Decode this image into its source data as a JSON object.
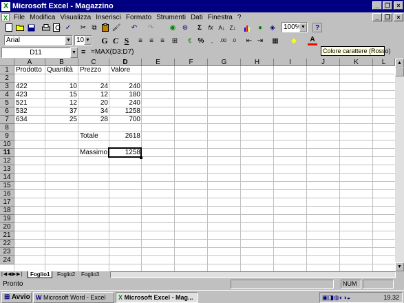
{
  "app": {
    "title": "Microsoft Excel - Magazzino"
  },
  "menu": [
    "File",
    "Modifica",
    "Visualizza",
    "Inserisci",
    "Formato",
    "Strumenti",
    "Dati",
    "Finestra",
    "?"
  ],
  "toolbar": {
    "zoom": "100%",
    "font": "Arial",
    "font_size": "10",
    "bold": "G",
    "italic": "C",
    "underline": "S",
    "percent": "%",
    "sum": "Σ",
    "fx": "fx"
  },
  "tooltip": "Colore carattere (Rosso)",
  "formula_bar": {
    "name_box": "D11",
    "equals": "=",
    "formula": "=MAX(D3:D7)"
  },
  "columns": [
    "A",
    "B",
    "C",
    "D",
    "E",
    "F",
    "G",
    "H",
    "I",
    "J",
    "K",
    "L"
  ],
  "rows": [
    "1",
    "2",
    "3",
    "4",
    "5",
    "6",
    "7",
    "8",
    "9",
    "10",
    "11",
    "12",
    "13",
    "14",
    "15",
    "16",
    "17",
    "18",
    "19",
    "20",
    "21",
    "22",
    "23",
    "24"
  ],
  "sheet": {
    "headers": {
      "prodotto": "Prodotto",
      "quantita": "Quantità",
      "prezzo": "Prezzo",
      "valore": "Valore"
    },
    "data": [
      {
        "prodotto": "422",
        "quantita": "10",
        "prezzo": "24",
        "valore": "240"
      },
      {
        "prodotto": "423",
        "quantita": "15",
        "prezzo": "12",
        "valore": "180"
      },
      {
        "prodotto": "521",
        "quantita": "12",
        "prezzo": "20",
        "valore": "240"
      },
      {
        "prodotto": "532",
        "quantita": "37",
        "prezzo": "34",
        "valore": "1258"
      },
      {
        "prodotto": "634",
        "quantita": "25",
        "prezzo": "28",
        "valore": "700"
      }
    ],
    "totale_label": "Totale",
    "totale_value": "2618",
    "massimo_label": "Massimo",
    "massimo_value": "1258"
  },
  "sheet_tabs": [
    "Foglio1",
    "Foglio2",
    "Foglio3"
  ],
  "status": {
    "text": "Pronto",
    "num": "NUM"
  },
  "taskbar": {
    "start": "Avvio",
    "task1": "Microsoft Word - Excel",
    "task2": "Microsoft Excel - Mag...",
    "clock": "19.32"
  }
}
